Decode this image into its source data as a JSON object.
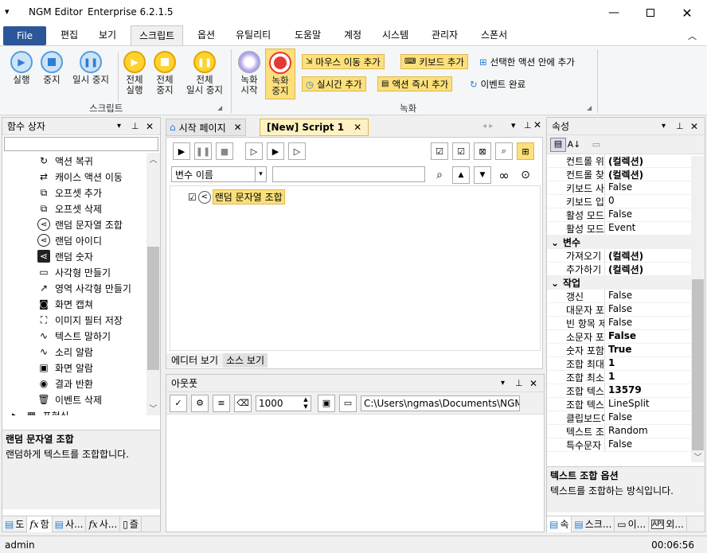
{
  "window": {
    "title": "NGM Editor",
    "edition": "Enterprise 6.2.1.5"
  },
  "menu": {
    "file": "File",
    "items": [
      "편집",
      "보기",
      "스크립트",
      "옵션",
      "유틸리티",
      "도움말",
      "계정",
      "시스템",
      "관리자",
      "스폰서"
    ]
  },
  "ribbon": {
    "script_group": "스크립트",
    "record_group": "녹화",
    "run": "실행",
    "stop": "중지",
    "pause": "일시 중지",
    "run_all": "전체\n실행",
    "stop_all": "전체\n중지",
    "pause_all": "전체\n일시 중지",
    "rec_start": "녹화\n시작",
    "rec_stop": "녹화\n중지",
    "mouse_move": "마우스 이동 추가",
    "keyboard": "키보드 추가",
    "inside_action": "선택한 액션 안에 추가",
    "realtime": "실시간 추가",
    "instant": "액션 즉시 추가",
    "event_done": "이벤트 완료"
  },
  "left": {
    "title": "함수 상자",
    "items": [
      {
        "icon": "refresh-icon",
        "label": "액션 복귀"
      },
      {
        "icon": "move-icon",
        "label": "캐이스 액션 이동"
      },
      {
        "icon": "offset-add-icon",
        "label": "오프셋 추가"
      },
      {
        "icon": "offset-delete-icon",
        "label": "오프셋 삭제"
      },
      {
        "icon": "share-icon",
        "label": "랜덤 문자열 조합"
      },
      {
        "icon": "share-icon",
        "label": "랜덤 아이디"
      },
      {
        "icon": "share-box-icon",
        "label": "랜덤 숫자"
      },
      {
        "icon": "rectangle-icon",
        "label": "사각형 만들기"
      },
      {
        "icon": "expand-icon",
        "label": "영역 사각형 만들기"
      },
      {
        "icon": "camera-icon",
        "label": "화면 캡쳐"
      },
      {
        "icon": "image-filter-icon",
        "label": "이미지 필터 저장"
      },
      {
        "icon": "wave-icon",
        "label": "텍스트 말하기"
      },
      {
        "icon": "wave-icon",
        "label": "소리 알람"
      },
      {
        "icon": "monitor-icon",
        "label": "화면 알람"
      },
      {
        "icon": "target-icon",
        "label": "결과 반환"
      },
      {
        "icon": "trash-icon",
        "label": "이벤트 삭제"
      },
      {
        "icon": "folder-icon",
        "label": "표현식"
      }
    ],
    "desc_title": "랜덤 문자열 조합",
    "desc_text": "랜덤하게 텍스트를 조합합니다.",
    "bottom_tabs": [
      "도",
      "함",
      "사...",
      "사...",
      "즐"
    ]
  },
  "center": {
    "tab1": "시작 페이지",
    "tab2": "[New] Script 1",
    "var_name": "변수 이름",
    "node": "랜덤 문자열 조합",
    "view_editor": "에디터 보기",
    "view_source": "소스 보기",
    "output_title": "아웃풋",
    "output_num": "1000",
    "output_path": "C:\\Users\\ngmas\\Documents\\NGM6\\"
  },
  "props": {
    "title": "속성",
    "rows": [
      {
        "type": "row",
        "k": "컨트롤 위치",
        "v": "(컬렉션)",
        "bold": true
      },
      {
        "type": "row",
        "k": "컨트롤 찾기",
        "v": "(컬렉션)",
        "bold": true
      },
      {
        "type": "row",
        "k": "키보드 사용",
        "v": "False"
      },
      {
        "type": "row",
        "k": "키보드 입력",
        "v": "0"
      },
      {
        "type": "row",
        "k": "활성 모드",
        "v": "False"
      },
      {
        "type": "row",
        "k": "활성 모드",
        "v": "Event"
      },
      {
        "type": "cat",
        "k": "변수"
      },
      {
        "type": "row",
        "k": "가져오기",
        "v": "(컬렉션)",
        "bold": true
      },
      {
        "type": "row",
        "k": "추가하기",
        "v": "(컬렉션)",
        "bold": true
      },
      {
        "type": "cat",
        "k": "작업"
      },
      {
        "type": "row",
        "k": "갱신",
        "v": "False"
      },
      {
        "type": "row",
        "k": "대문자 포함",
        "v": "False"
      },
      {
        "type": "row",
        "k": "빈 항목 제거",
        "v": "False"
      },
      {
        "type": "row",
        "k": "소문자 포함",
        "v": "False",
        "bold": true
      },
      {
        "type": "row",
        "k": "숫자 포함",
        "v": "True",
        "bold": true
      },
      {
        "type": "row",
        "k": "조합 최대",
        "v": "1",
        "bold": true
      },
      {
        "type": "row",
        "k": "조합 최소",
        "v": "1",
        "bold": true
      },
      {
        "type": "row",
        "k": "조합 텍스트",
        "v": "13579",
        "bold": true
      },
      {
        "type": "row",
        "k": "조합 텍스트",
        "v": "LineSplit"
      },
      {
        "type": "row",
        "k": "클립보드에",
        "v": "False"
      },
      {
        "type": "row",
        "k": "텍스트 조합",
        "v": "Random"
      },
      {
        "type": "row",
        "k": "특수문자",
        "v": "False"
      }
    ],
    "desc_title": "텍스트 조합 옵션",
    "desc_text": "텍스트를 조합하는 방식입니다.",
    "bottom_tabs": [
      "속",
      "스크...",
      "이...",
      "외..."
    ]
  },
  "status": {
    "user": "admin",
    "time": "00:06:56"
  }
}
